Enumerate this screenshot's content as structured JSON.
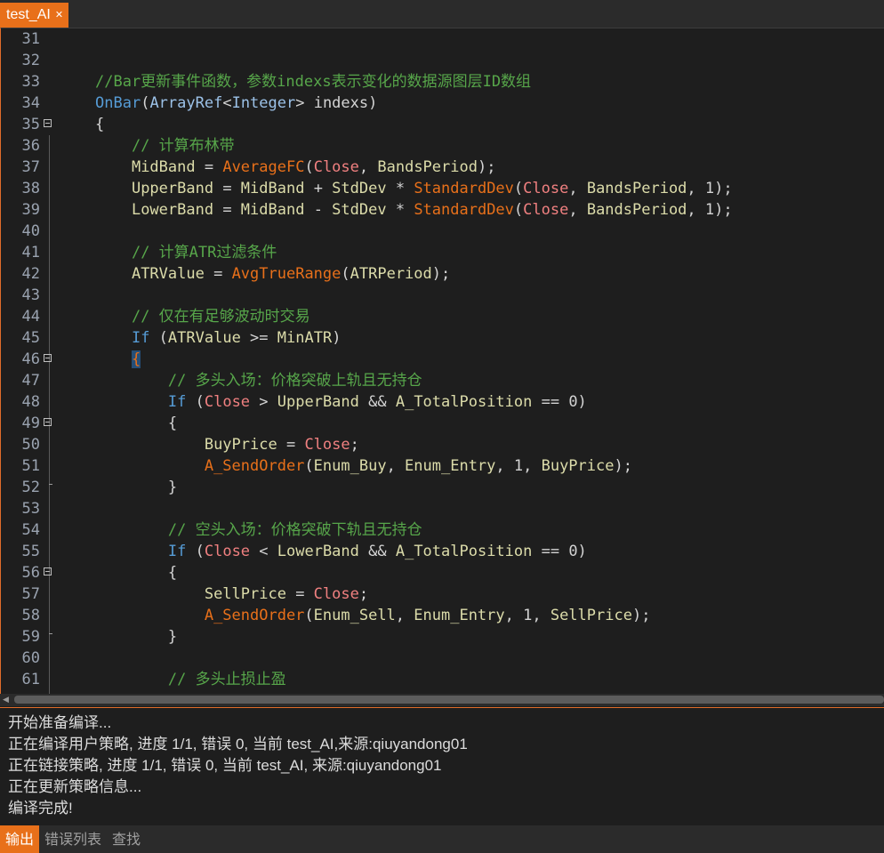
{
  "tabs": [
    {
      "label": "test_AI",
      "active": true
    }
  ],
  "editor": {
    "lines": [
      {
        "num": "31",
        "fold": "",
        "tokens": []
      },
      {
        "num": "32",
        "fold": "",
        "tokens": []
      },
      {
        "num": "33",
        "fold": "",
        "tokens": [
          [
            "cm",
            "//Bar更新事件函数，参数indexs表示变化的数据源图层ID数组"
          ]
        ]
      },
      {
        "num": "34",
        "fold": "",
        "tokens": [
          [
            "kw",
            "OnBar"
          ],
          [
            "op",
            "("
          ],
          [
            "ty",
            "ArrayRef"
          ],
          [
            "op",
            "<"
          ],
          [
            "ty",
            "Integer"
          ],
          [
            "op",
            "> indexs)"
          ]
        ]
      },
      {
        "num": "35",
        "fold": "open",
        "tokens": [
          [
            "op",
            "{"
          ]
        ]
      },
      {
        "num": "36",
        "fold": "",
        "tokens": [
          [
            "op",
            "    "
          ],
          [
            "cm",
            "// 计算布林带"
          ]
        ]
      },
      {
        "num": "37",
        "fold": "",
        "tokens": [
          [
            "op",
            "    "
          ],
          [
            "va",
            "MidBand"
          ],
          [
            "op",
            " = "
          ],
          [
            "fn",
            "AverageFC"
          ],
          [
            "op",
            "("
          ],
          [
            "rd",
            "Close"
          ],
          [
            "op",
            ", "
          ],
          [
            "va",
            "BandsPeriod"
          ],
          [
            "op",
            ");"
          ]
        ]
      },
      {
        "num": "38",
        "fold": "",
        "tokens": [
          [
            "op",
            "    "
          ],
          [
            "va",
            "UpperBand"
          ],
          [
            "op",
            " = "
          ],
          [
            "va",
            "MidBand"
          ],
          [
            "op",
            " + "
          ],
          [
            "va",
            "StdDev"
          ],
          [
            "op",
            " * "
          ],
          [
            "fn",
            "StandardDev"
          ],
          [
            "op",
            "("
          ],
          [
            "rd",
            "Close"
          ],
          [
            "op",
            ", "
          ],
          [
            "va",
            "BandsPeriod"
          ],
          [
            "op",
            ", 1);"
          ]
        ]
      },
      {
        "num": "39",
        "fold": "",
        "tokens": [
          [
            "op",
            "    "
          ],
          [
            "va",
            "LowerBand"
          ],
          [
            "op",
            " = "
          ],
          [
            "va",
            "MidBand"
          ],
          [
            "op",
            " - "
          ],
          [
            "va",
            "StdDev"
          ],
          [
            "op",
            " * "
          ],
          [
            "fn",
            "StandardDev"
          ],
          [
            "op",
            "("
          ],
          [
            "rd",
            "Close"
          ],
          [
            "op",
            ", "
          ],
          [
            "va",
            "BandsPeriod"
          ],
          [
            "op",
            ", 1);"
          ]
        ]
      },
      {
        "num": "40",
        "fold": "",
        "tokens": []
      },
      {
        "num": "41",
        "fold": "",
        "tokens": [
          [
            "op",
            "    "
          ],
          [
            "cm",
            "// 计算ATR过滤条件"
          ]
        ]
      },
      {
        "num": "42",
        "fold": "",
        "tokens": [
          [
            "op",
            "    "
          ],
          [
            "va",
            "ATRValue"
          ],
          [
            "op",
            " = "
          ],
          [
            "fn",
            "AvgTrueRange"
          ],
          [
            "op",
            "("
          ],
          [
            "va",
            "ATRPeriod"
          ],
          [
            "op",
            ");"
          ]
        ]
      },
      {
        "num": "43",
        "fold": "",
        "tokens": []
      },
      {
        "num": "44",
        "fold": "",
        "tokens": [
          [
            "op",
            "    "
          ],
          [
            "cm",
            "// 仅在有足够波动时交易"
          ]
        ]
      },
      {
        "num": "45",
        "fold": "",
        "tokens": [
          [
            "op",
            "    "
          ],
          [
            "kw",
            "If"
          ],
          [
            "op",
            " ("
          ],
          [
            "va",
            "ATRValue"
          ],
          [
            "op",
            " >= "
          ],
          [
            "va",
            "MinATR"
          ],
          [
            "op",
            ")"
          ]
        ]
      },
      {
        "num": "46",
        "fold": "open",
        "tokens": [
          [
            "op",
            "    "
          ],
          [
            "hl",
            "{"
          ]
        ]
      },
      {
        "num": "47",
        "fold": "",
        "tokens": [
          [
            "op",
            "        "
          ],
          [
            "cm",
            "// 多头入场：价格突破上轨且无持仓"
          ]
        ]
      },
      {
        "num": "48",
        "fold": "",
        "tokens": [
          [
            "op",
            "        "
          ],
          [
            "kw",
            "If"
          ],
          [
            "op",
            " ("
          ],
          [
            "rd",
            "Close"
          ],
          [
            "op",
            " > "
          ],
          [
            "va",
            "UpperBand"
          ],
          [
            "op",
            " && "
          ],
          [
            "va",
            "A_TotalPosition"
          ],
          [
            "op",
            " == 0)"
          ]
        ]
      },
      {
        "num": "49",
        "fold": "open",
        "tokens": [
          [
            "op",
            "        {"
          ]
        ]
      },
      {
        "num": "50",
        "fold": "",
        "tokens": [
          [
            "op",
            "            "
          ],
          [
            "va",
            "BuyPrice"
          ],
          [
            "op",
            " = "
          ],
          [
            "rd",
            "Close"
          ],
          [
            "op",
            ";"
          ]
        ]
      },
      {
        "num": "51",
        "fold": "",
        "tokens": [
          [
            "op",
            "            "
          ],
          [
            "fn",
            "A_SendOrder"
          ],
          [
            "op",
            "("
          ],
          [
            "va",
            "Enum_Buy"
          ],
          [
            "op",
            ", "
          ],
          [
            "va",
            "Enum_Entry"
          ],
          [
            "op",
            ", 1, "
          ],
          [
            "va",
            "BuyPrice"
          ],
          [
            "op",
            ");"
          ]
        ]
      },
      {
        "num": "52",
        "fold": "end",
        "tokens": [
          [
            "op",
            "        }"
          ]
        ]
      },
      {
        "num": "53",
        "fold": "",
        "tokens": []
      },
      {
        "num": "54",
        "fold": "",
        "tokens": [
          [
            "op",
            "        "
          ],
          [
            "cm",
            "// 空头入场：价格突破下轨且无持仓"
          ]
        ]
      },
      {
        "num": "55",
        "fold": "",
        "tokens": [
          [
            "op",
            "        "
          ],
          [
            "kw",
            "If"
          ],
          [
            "op",
            " ("
          ],
          [
            "rd",
            "Close"
          ],
          [
            "op",
            " < "
          ],
          [
            "va",
            "LowerBand"
          ],
          [
            "op",
            " && "
          ],
          [
            "va",
            "A_TotalPosition"
          ],
          [
            "op",
            " == 0)"
          ]
        ]
      },
      {
        "num": "56",
        "fold": "open",
        "tokens": [
          [
            "op",
            "        {"
          ]
        ]
      },
      {
        "num": "57",
        "fold": "",
        "tokens": [
          [
            "op",
            "            "
          ],
          [
            "va",
            "SellPrice"
          ],
          [
            "op",
            " = "
          ],
          [
            "rd",
            "Close"
          ],
          [
            "op",
            ";"
          ]
        ]
      },
      {
        "num": "58",
        "fold": "",
        "tokens": [
          [
            "op",
            "            "
          ],
          [
            "fn",
            "A_SendOrder"
          ],
          [
            "op",
            "("
          ],
          [
            "va",
            "Enum_Sell"
          ],
          [
            "op",
            ", "
          ],
          [
            "va",
            "Enum_Entry"
          ],
          [
            "op",
            ", 1, "
          ],
          [
            "va",
            "SellPrice"
          ],
          [
            "op",
            ");"
          ]
        ]
      },
      {
        "num": "59",
        "fold": "end",
        "tokens": [
          [
            "op",
            "        }"
          ]
        ]
      },
      {
        "num": "60",
        "fold": "",
        "tokens": []
      },
      {
        "num": "61",
        "fold": "",
        "tokens": [
          [
            "op",
            "        "
          ],
          [
            "cm",
            "// 多头止损止盈"
          ]
        ]
      }
    ]
  },
  "output": {
    "lines": [
      "开始准备编译...",
      "正在编译用户策略, 进度 1/1, 错误 0, 当前 test_AI,来源:qiuyandong01",
      "正在链接策略, 进度 1/1, 错误 0, 当前 test_AI, 来源:qiuyandong01",
      "正在更新策略信息...",
      "编译完成!"
    ]
  },
  "bottom_tabs": [
    {
      "label": "输出",
      "active": true
    },
    {
      "label": "错误列表",
      "active": false
    },
    {
      "label": "查找",
      "active": false
    }
  ],
  "colors": {
    "accent": "#e8701a",
    "comment": "#57a64a",
    "keyword": "#569cd6",
    "function": "#e8701a",
    "variable": "#dcdcaa",
    "builtin_series": "#f08080",
    "background": "#1e1e1e"
  },
  "icons": {
    "tab_close": "close-icon",
    "fold_open": "fold-collapse-icon",
    "scroll_left": "chevron-left-icon"
  }
}
